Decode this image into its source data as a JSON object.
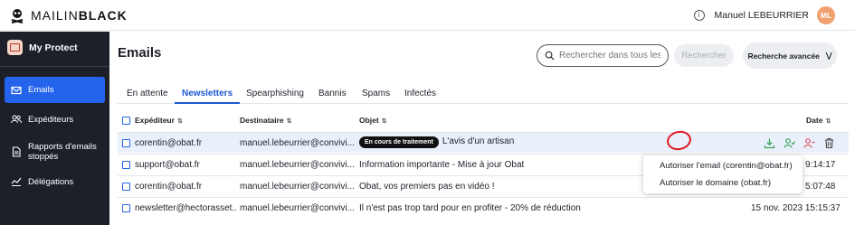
{
  "brand": {
    "name_light": "MAILIN",
    "name_bold": "BLACK"
  },
  "topbar": {
    "info_icon": "info-icon",
    "user_name": "Manuel LEBEURRIER",
    "avatar_initials": "ML",
    "avatar_color": "#f0a070"
  },
  "sidebar": {
    "header": "My Protect",
    "items": [
      {
        "label": "Emails",
        "icon": "envelope-icon",
        "active": true
      },
      {
        "label": "Expéditeurs",
        "icon": "users-icon",
        "active": false
      },
      {
        "label": "Rapports d'emails stoppés",
        "icon": "document-icon",
        "active": false
      },
      {
        "label": "Délégations",
        "icon": "delegation-icon",
        "active": false
      }
    ]
  },
  "main": {
    "title": "Emails",
    "search": {
      "placeholder": "Rechercher dans tous les emails",
      "button": "Rechercher"
    },
    "advanced_search": "Recherche avancée",
    "tabs": [
      "En attente",
      "Newsletters",
      "Spearphishing",
      "Bannis",
      "Spams",
      "Infectés"
    ],
    "active_tab": "Newsletters"
  },
  "table": {
    "columns": {
      "sender": "Expéditeur",
      "recipient": "Destinataire",
      "subject": "Objet",
      "date": "Date"
    },
    "rows": [
      {
        "sender": "corentin@obat.fr",
        "recipient": "manuel.lebeurrier@convivi...",
        "badge": "En cours de traitement",
        "subject": "L'avis d'un artisan",
        "date": ""
      },
      {
        "sender": "support@obat.fr",
        "recipient": "manuel.lebeurrier@convivi...",
        "badge": "",
        "subject": "Information importante - Mise à jour Obat",
        "date": "9:14:17"
      },
      {
        "sender": "corentin@obat.fr",
        "recipient": "manuel.lebeurrier@convivi...",
        "badge": "",
        "subject": "Obat, vos premiers pas en vidéo !",
        "date": "5:07:48"
      },
      {
        "sender": "newsletter@hectorasset...",
        "recipient": "manuel.lebeurrier@convivi...",
        "badge": "",
        "subject": "Il n'est pas trop tard pour en profiter - 20% de réduction",
        "date": "15 nov. 2023 15:15:37"
      }
    ]
  },
  "context_menu": {
    "items": [
      "Autoriser l'email (corentin@obat.fr)",
      "Autoriser le domaine (obat.fr)"
    ]
  },
  "colors": {
    "accent": "#2463eb",
    "sidebar_bg": "#1d2029",
    "annotation": "#e0181f",
    "selected_row": "#eaf0fb"
  }
}
